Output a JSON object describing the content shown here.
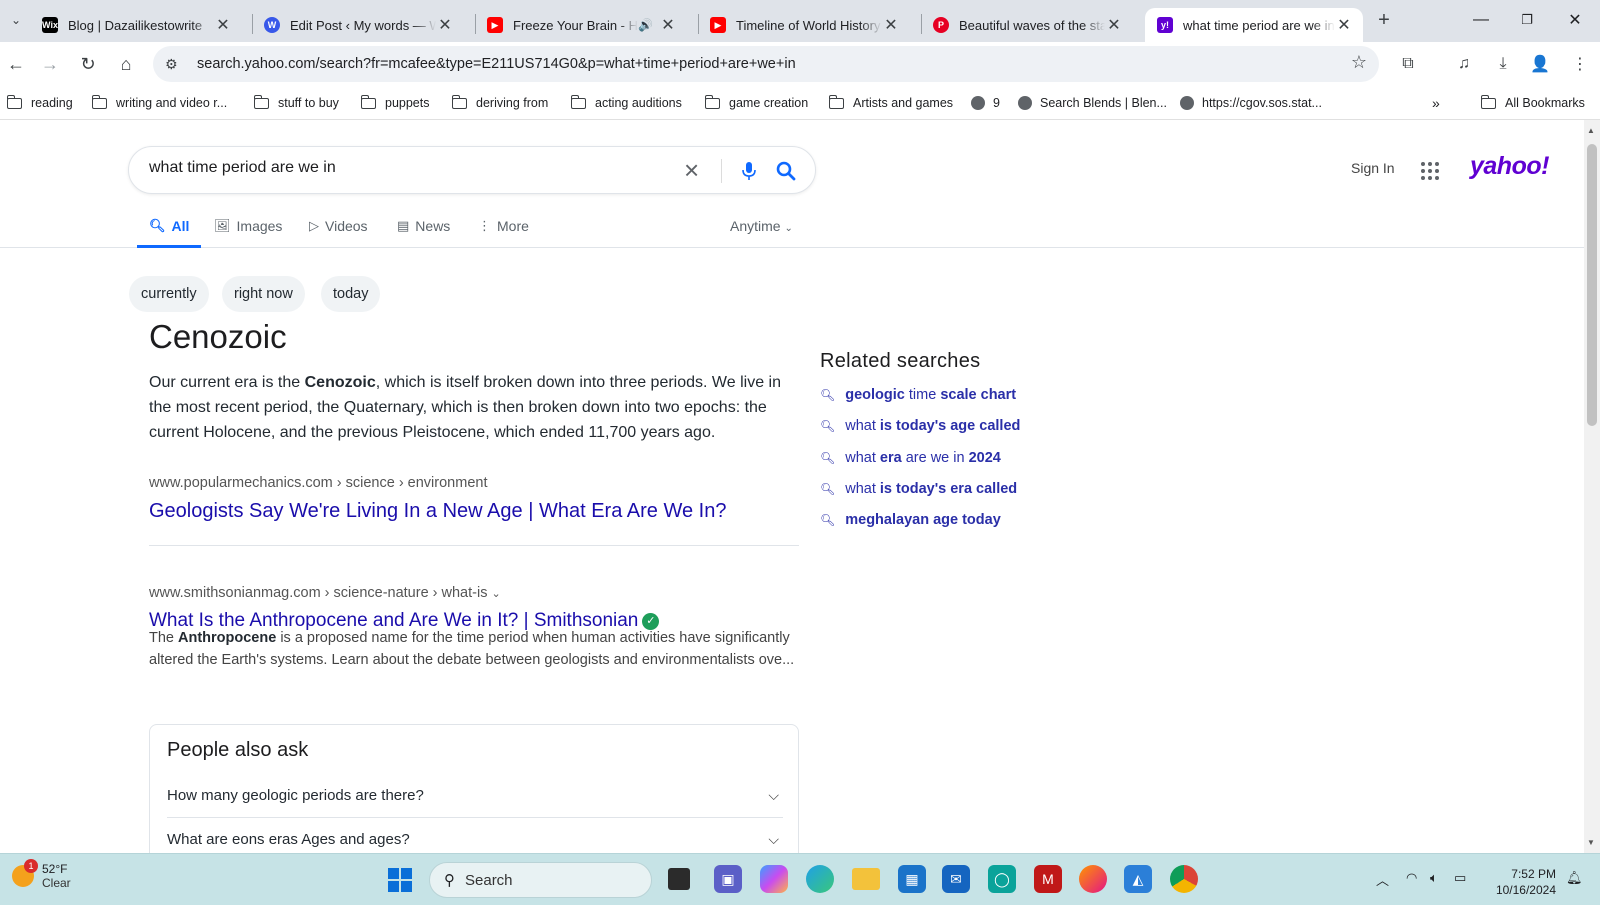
{
  "browser": {
    "tabs": [
      {
        "title": "Blog | Dazailikestowrite",
        "favicon": "wix-icon",
        "color": "#000000"
      },
      {
        "title": "Edit Post ‹ My words — WordPress",
        "favicon": "wordpress-icon",
        "color": "#3858e9"
      },
      {
        "title": "Freeze Your Brain - Heathers",
        "favicon": "youtube-icon",
        "color": "#ff0000"
      },
      {
        "title": "Timeline of World History | Years",
        "favicon": "youtube-icon",
        "color": "#ff0000"
      },
      {
        "title": "Beautiful waves of the starry night",
        "favicon": "pinterest-icon",
        "color": "#e60023"
      },
      {
        "title": "what time period are we in - Yahoo",
        "favicon": "yahoo-icon",
        "color": "#6001d2"
      }
    ],
    "url": "search.yahoo.com/search?fr=mcafee&type=E211US714G0&p=what+time+period+are+we+in",
    "bookmarks": [
      {
        "label": "reading",
        "type": "folder"
      },
      {
        "label": "writing and video r...",
        "type": "folder"
      },
      {
        "label": "stuff to buy",
        "type": "folder"
      },
      {
        "label": "puppets",
        "type": "folder"
      },
      {
        "label": "deriving from",
        "type": "folder"
      },
      {
        "label": "acting auditions",
        "type": "folder"
      },
      {
        "label": "game creation",
        "type": "folder"
      },
      {
        "label": "Artists and games",
        "type": "folder"
      },
      {
        "label": "9",
        "type": "globe"
      },
      {
        "label": "Search Blends | Blen...",
        "type": "globe"
      },
      {
        "label": "https://cgov.sos.stat...",
        "type": "globe"
      }
    ],
    "all_bookmarks": "All Bookmarks"
  },
  "search": {
    "query": "what time period are we in",
    "sign_in": "Sign In",
    "logo": "yahoo!",
    "tabs": [
      "All",
      "Images",
      "Videos",
      "News",
      "More"
    ],
    "anytime": "Anytime",
    "chips": [
      "currently",
      "right now",
      "today"
    ]
  },
  "answer": {
    "title": "Cenozoic",
    "text_before": "Our current era is the ",
    "text_bold": "Cenozoic",
    "text_after": ", which is itself broken down into three periods. We live in the most recent period, the Quaternary, which is then broken down into two epochs: the current Holocene, and the previous Pleistocene, which ended 11,700 years ago.",
    "source": "www.popularmechanics.com › science › environment",
    "link": "Geologists Say We're Living In a New Age | What Era Are We In?"
  },
  "result2": {
    "source": "www.smithsonianmag.com › science-nature › what-is",
    "link": "What Is the Anthropocene and Are We in It? | Smithsonian",
    "snippet_before": "The ",
    "snippet_bold": "Anthropocene",
    "snippet_after": " is a proposed name for the time period when human activities have significantly altered the Earth's systems. Learn about the debate between geologists and environmentalists ove..."
  },
  "paa": {
    "title": "People also ask",
    "questions": [
      "How many geologic periods are there?",
      "What are eons eras Ages and ages?"
    ]
  },
  "related": {
    "title": "Related searches",
    "items": [
      [
        {
          "t": "geologic ",
          "b": true
        },
        {
          "t": "time",
          "b": false
        },
        {
          "t": " scale chart",
          "b": true
        }
      ],
      [
        {
          "t": "what ",
          "b": false
        },
        {
          "t": "is today's age called",
          "b": true
        }
      ],
      [
        {
          "t": "what ",
          "b": false
        },
        {
          "t": "era",
          "b": true
        },
        {
          "t": " are we in ",
          "b": false
        },
        {
          "t": "2024",
          "b": true
        }
      ],
      [
        {
          "t": "what ",
          "b": false
        },
        {
          "t": "is today's era called",
          "b": true
        }
      ],
      [
        {
          "t": "meghalayan age today",
          "b": true
        }
      ]
    ]
  },
  "taskbar": {
    "weather_temp": "52°F",
    "weather_cond": "Clear",
    "weather_badge": "1",
    "search_label": "Search",
    "time": "7:52 PM",
    "date": "10/16/2024"
  }
}
